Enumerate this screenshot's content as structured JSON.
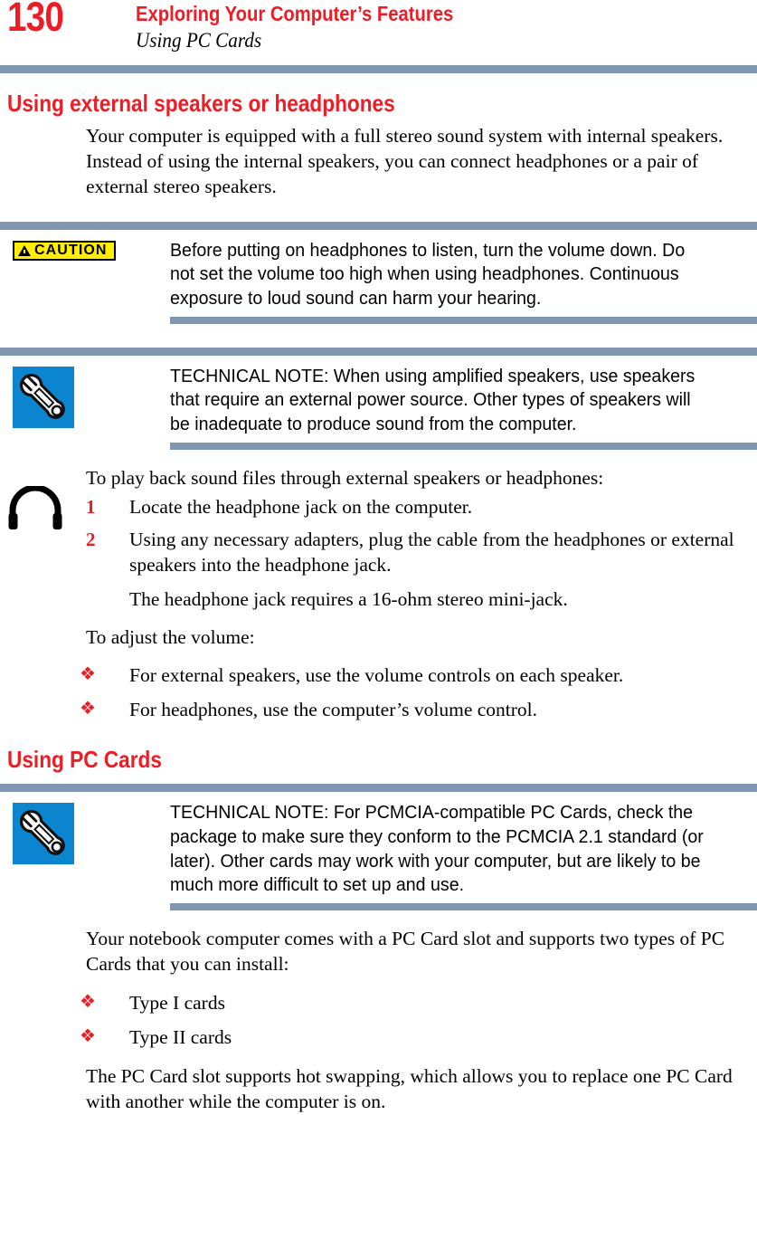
{
  "header": {
    "page_number": "130",
    "title": "Exploring Your Computer’s Features",
    "subtitle": "Using PC Cards"
  },
  "colors": {
    "accent_red": "#ee1c25",
    "rule_blue_gray": "#8197b1",
    "caution_yellow": "#ffee00",
    "note_icon_blue": "#0b85d0"
  },
  "sections": {
    "speakers": {
      "heading": "Using external speakers or headphones",
      "intro": "Your computer is equipped with a full stereo sound system with internal speakers. Instead of using the internal speakers, you can connect headphones or a pair of external stereo speakers.",
      "caution": {
        "badge_label": "CAUTION",
        "icon": "warning-triangle-icon",
        "text": "Before putting on headphones to listen, turn the volume down. Do not set the volume too high when using headphones. Continuous exposure to loud sound can harm your hearing."
      },
      "note": {
        "icon": "wrench-icon",
        "text": "TECHNICAL NOTE: When using amplified speakers, use speakers that require an external power source. Other types of speakers will be inadequate to produce sound from the computer."
      },
      "procedure_intro": "To play back sound files through external speakers or headphones:",
      "procedure_icon": "headphones-icon",
      "steps": [
        {
          "number": "1",
          "text": "Locate the headphone jack on the computer."
        },
        {
          "number": "2",
          "text": "Using any necessary adapters, plug the cable from the headphones or external speakers into the headphone jack."
        }
      ],
      "step_followup": "The headphone jack requires a 16-ohm stereo mini-jack.",
      "volume_intro": "To adjust the volume:",
      "volume_bullets": [
        "For external speakers, use the volume controls on each speaker.",
        "For headphones, use the computer’s volume control."
      ]
    },
    "pc_cards": {
      "heading": "Using PC Cards",
      "note": {
        "icon": "wrench-icon",
        "text": "TECHNICAL NOTE: For PCMCIA-compatible PC Cards, check the package to make sure they conform to the PCMCIA 2.1 standard (or later). Other cards may work with your computer, but are likely to be much more difficult to set up and use."
      },
      "intro": "Your notebook computer comes with a PC Card slot and supports two types of PC Cards that you can install:",
      "card_types": [
        "Type I cards",
        "Type II cards"
      ],
      "closing": "The PC Card slot supports hot swapping, which allows you to replace one PC Card with another while the computer is on."
    }
  },
  "bullet_glyph": "❖"
}
